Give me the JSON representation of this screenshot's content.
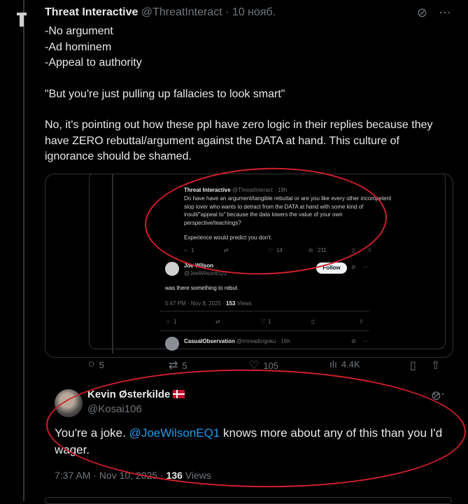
{
  "tweet": {
    "author_name": "Threat Interactive",
    "handle": "@ThreatInteract",
    "date": "· 10 нояб.",
    "lines": [
      "-No argument",
      "-Ad hominem",
      "-Appeal to authority"
    ],
    "quote_line": "\"But you're just pulling up fallacies to look smart\"",
    "paragraph": "No, it's pointing out how these ppl have zero logic in their replies because they have ZERO rebuttal/argument against the DATA at hand. This culture of ignorance should be shamed.",
    "actions": {
      "replies": "5",
      "reposts": "5",
      "likes": "105",
      "views": "4.4K"
    }
  },
  "screenshot": {
    "top_tweet": {
      "author": "Threat Interactive",
      "handle": "@ThreatInteract · 19h",
      "text": "Do have have an argument/tangible rebuttal or are you like every other incompetent slop lover who wants to detract from the DATA at hand with some kind of insult/\"appeal to\" because the data lowers the value of your own perspective/teachings?",
      "text2": "Experience would predict you don't.",
      "replies": "1",
      "likes": "14",
      "views": "211"
    },
    "joe": {
      "name": "Joe Wilson",
      "handle": "@JoeWilsonEQ1",
      "follow_label": "Follow",
      "text": "was there something to rebut",
      "time": "5:47 PM · Nov 8, 2025 · ",
      "views_count": "153",
      "views_label": " Views",
      "replies": "1",
      "likes": "1"
    },
    "casual": {
      "name": "CasualObservation",
      "handle": "@imreadingoku · 16h"
    }
  },
  "reply": {
    "name": "Kevin Østerkilde",
    "handle": "@Kosai106",
    "text_before": "You're a joke. ",
    "mention": "@JoeWilsonEQ1",
    "text_after": " knows more about any of this than you I'd wager.",
    "time": "7:37 AM · Nov 10, 2025 · ",
    "views_count": "136",
    "views_label": " Views"
  },
  "colors": {
    "accent": "#1d9bf0",
    "annotation": "#d11f2a",
    "background": "#000000"
  },
  "icons": [
    "grok-icon",
    "more-icon",
    "reply-icon",
    "repost-icon",
    "like-icon",
    "views-icon",
    "bookmark-icon",
    "share-icon"
  ]
}
